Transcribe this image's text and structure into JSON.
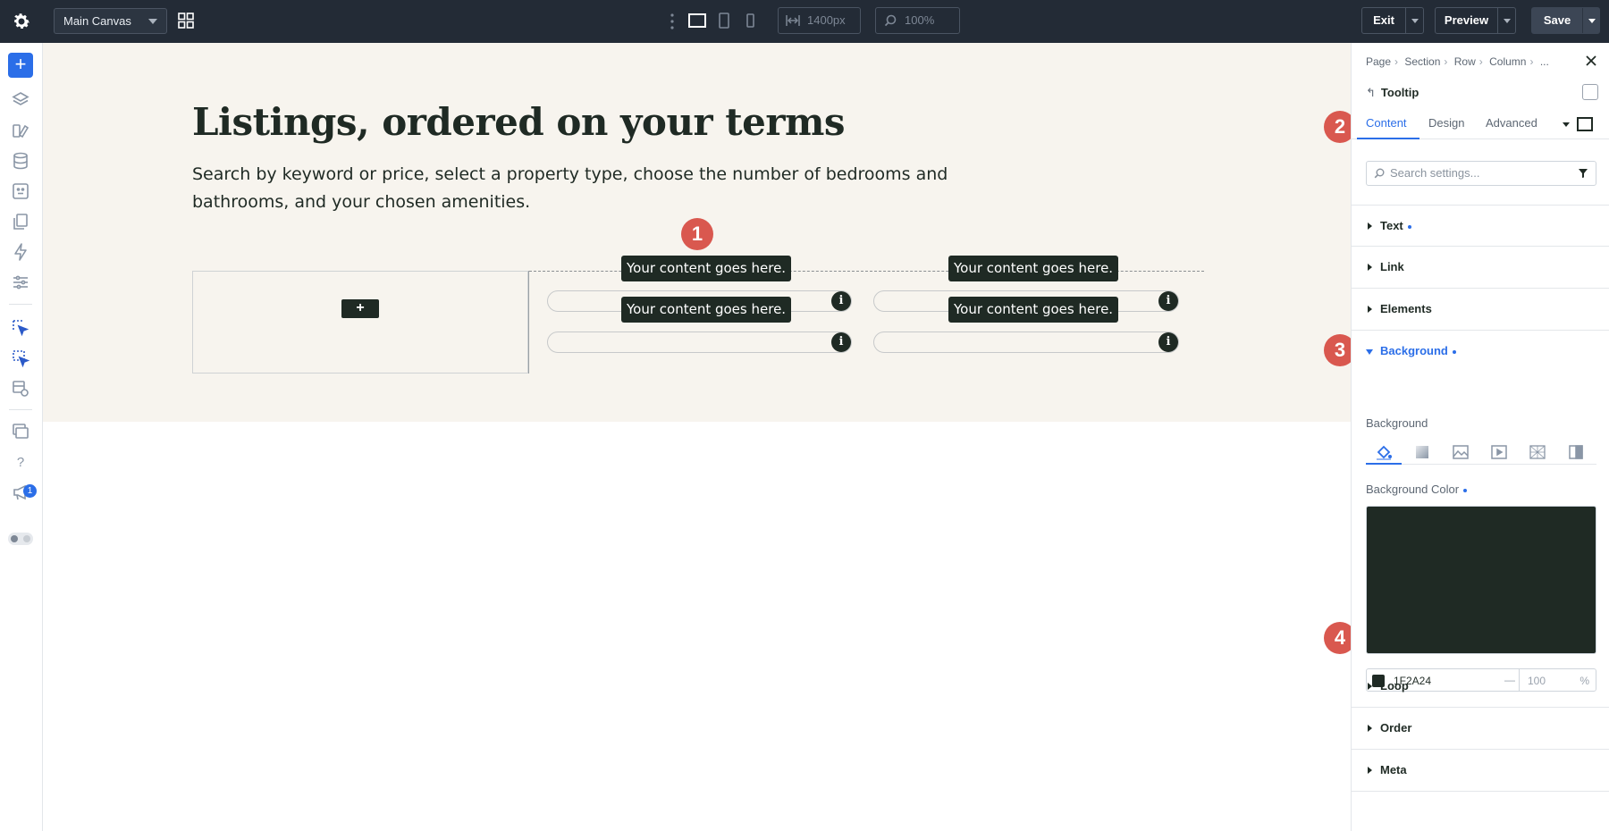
{
  "topbar": {
    "canvas_select": "Main Canvas",
    "width_value": "1400px",
    "zoom_value": "100%",
    "exit_label": "Exit",
    "preview_label": "Preview",
    "save_label": "Save"
  },
  "leftbar": {
    "notification_count": "1"
  },
  "canvas": {
    "heading": "Listings, ordered on your terms",
    "intro": "Search by keyword or price, select a property type, choose the number of bedrooms and bathrooms, and your chosen amenities.",
    "add_label": "+",
    "tooltip_text": "Your content goes here.",
    "info_glyph": "i"
  },
  "callouts": [
    "1",
    "2",
    "3",
    "4"
  ],
  "panel": {
    "breadcrumb": [
      "Page",
      "Section",
      "Row",
      "Column",
      "..."
    ],
    "module_title": "Tooltip",
    "tabs": [
      "Content",
      "Design",
      "Advanced"
    ],
    "search_placeholder": "Search settings...",
    "groups": {
      "text": "Text",
      "link": "Link",
      "elements": "Elements",
      "background": "Background",
      "loop": "Loop",
      "order": "Order",
      "meta": "Meta"
    },
    "background_sub_label": "Background",
    "background_color_label": "Background Color",
    "color_hex": "1F2A24",
    "opacity_placeholder": "100",
    "opacity_unit": "%",
    "swatch_color": "#1F2A24"
  },
  "colors": {
    "accent": "#2b6ee8",
    "callout": "#d9584f",
    "topbar": "#232b36",
    "section_bg": "#f7f4ee",
    "tooltip_bg": "#1f2a24"
  }
}
